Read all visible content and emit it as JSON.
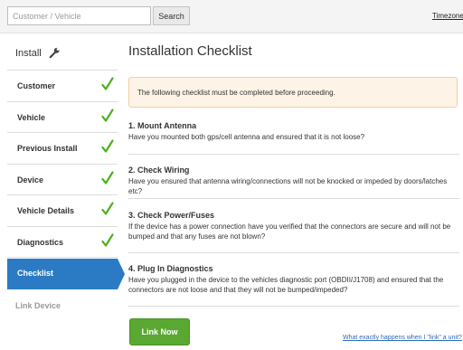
{
  "header": {
    "search_placeholder": "Customer / Vehicle",
    "search_button": "Search",
    "timezone_link": "Timezone"
  },
  "sidebar": {
    "title": "Install",
    "items": [
      {
        "label": "Customer",
        "status": "complete"
      },
      {
        "label": "Vehicle",
        "status": "complete"
      },
      {
        "label": "Previous Install",
        "status": "complete"
      },
      {
        "label": "Device",
        "status": "complete"
      },
      {
        "label": "Vehicle Details",
        "status": "complete"
      },
      {
        "label": "Diagnostics",
        "status": "complete"
      },
      {
        "label": "Checklist",
        "status": "active"
      },
      {
        "label": "Link Device",
        "status": "disabled"
      }
    ]
  },
  "main": {
    "title": "Installation Checklist",
    "alert": "The following checklist must be completed before proceeding.",
    "steps": [
      {
        "title": "1. Mount Antenna",
        "body": "Have you mounted both gps/cell antenna and ensured that it is not loose?"
      },
      {
        "title": "2. Check Wiring",
        "body": "Have you ensured that antenna wiring/connections will not be knocked or impeded by doors/latches etc?"
      },
      {
        "title": "3. Check Power/Fuses",
        "body": "If the device has a power connection have you verified that the connectors are secure and will not be bumped and that any fuses are not blown?"
      },
      {
        "title": "4. Plug In Diagnostics",
        "body": "Have you plugged in the device to the vehicles diagnostic port (OBDII/J1708) and ensured that the connectors are not loose and that they will not be bumped/impeded?"
      }
    ],
    "link_button": "Link Now",
    "help_link": "What exactly happens when I \"link\" a unit?"
  },
  "colors": {
    "accent_blue": "#2b7bc4",
    "check_green": "#4caf1e",
    "button_green": "#5aa832",
    "alert_bg": "#fdf3e6",
    "alert_border": "#f1cfa4"
  }
}
